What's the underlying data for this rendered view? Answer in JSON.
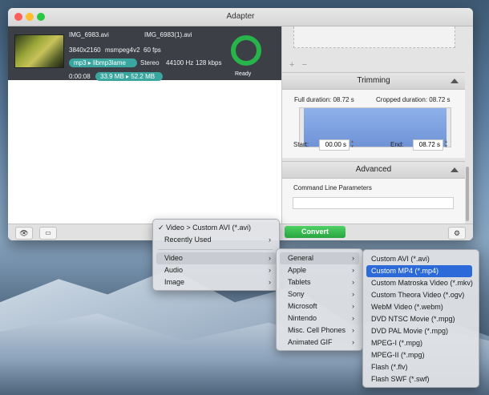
{
  "window": {
    "title": "Adapter"
  },
  "file": {
    "source_name": "IMG_6983.avi",
    "output_name": "IMG_6983(1).avi",
    "resolution": "3840x2160",
    "codec": "msmpeg4v2",
    "fps": "60 fps",
    "audio_codec": "mp3",
    "audio_output_codec": "libmp3lame",
    "channels": "Stereo",
    "sample_rate": "44100 Hz",
    "bitrate": "128 kbps",
    "duration": "0:00:08",
    "source_size": "33.9 MB",
    "output_size": "52.2 MB",
    "status": "Ready"
  },
  "trimming": {
    "header": "Trimming",
    "full_duration": "Full duration: 08.72 s",
    "cropped_duration": "Cropped duration: 08.72 s",
    "start_label": "Start:",
    "start_value": "00.00 s",
    "end_label": "End:",
    "end_value": "08.72 s"
  },
  "advanced": {
    "header": "Advanced",
    "cmd_label": "Command Line Parameters",
    "cmd_value": ""
  },
  "toolbar": {
    "convert_label": "Convert",
    "plus": "+",
    "minus": "−"
  },
  "menu_main": {
    "checked_item": "Video > Custom AVI (*.avi)",
    "recently_used": "Recently Used",
    "items": [
      "Video",
      "Audio",
      "Image"
    ]
  },
  "menu_video": {
    "items": [
      "General",
      "Apple",
      "Tablets",
      "Sony",
      "Microsoft",
      "Nintendo",
      "Misc. Cell Phones",
      "Animated GIF"
    ]
  },
  "menu_general": {
    "selected": "Custom MP4 (*.mp4)",
    "items": [
      "Custom AVI (*.avi)",
      "Custom MP4 (*.mp4)",
      "Custom Matroska Video (*.mkv)",
      "Custom Theora Video (*.ogv)",
      "WebM Video (*.webm)",
      "DVD NTSC Movie (*.mpg)",
      "DVD PAL Movie (*.mpg)",
      "MPEG-I (*.mpg)",
      "MPEG-II (*.mpg)",
      "Flash (*.flv)",
      "Flash SWF (*.swf)"
    ]
  },
  "colors": {
    "accent": "#2b6ad8",
    "convert": "#2fae45",
    "status_ring": "#27b44a",
    "pill": "#3aa6a0"
  }
}
